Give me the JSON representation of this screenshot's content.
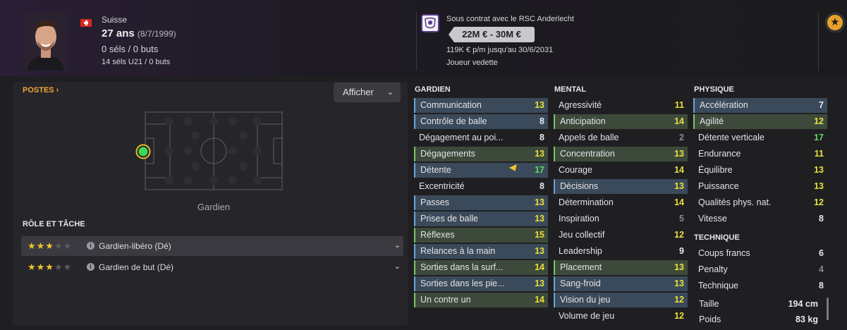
{
  "header": {
    "nationality": "Suisse",
    "age": "27 ans",
    "birthdate": "(8/7/1999)",
    "caps": "0 séls / 0 buts",
    "u21_caps": "14 séls U21 / 0 buts",
    "contract_club": "Sous contrat avec le RSC Anderlecht",
    "value_range": "22M € - 30M €",
    "wage": "119K € p/m jusqu'au 30/6/2031",
    "status": "Joueur vedette",
    "star_icon": "star-icon"
  },
  "positions": {
    "title": "POSTES ›",
    "display_button": "Afficher",
    "position_label": "Gardien"
  },
  "roles": {
    "title": "RÔLE ET TÂCHE",
    "items": [
      {
        "name": "Gardien-libéro (Dé)",
        "stars": 3,
        "max": 5
      },
      {
        "name": "Gardien de but (Dé)",
        "stars": 3,
        "max": 5
      }
    ]
  },
  "columns": {
    "goalkeeper": "GARDIEN",
    "mental": "MENTAL",
    "physical": "PHYSIQUE",
    "technical": "TECHNIQUE"
  },
  "goalkeeper": [
    {
      "name": "Communication",
      "value": "13",
      "hl": "hb",
      "color": "v-yellow"
    },
    {
      "name": "Contrôle de balle",
      "value": "8",
      "hl": "hb",
      "color": "v-white"
    },
    {
      "name": "Dégagement au poi...",
      "value": "8",
      "hl": "none",
      "color": "v-white"
    },
    {
      "name": "Dégagements",
      "value": "13",
      "hl": "hg",
      "color": "v-yellow"
    },
    {
      "name": "Détente",
      "value": "17",
      "hl": "hb",
      "color": "v-green"
    },
    {
      "name": "Excentricité",
      "value": "8",
      "hl": "none",
      "color": "v-white"
    },
    {
      "name": "Passes",
      "value": "13",
      "hl": "hb",
      "color": "v-yellow"
    },
    {
      "name": "Prises de balle",
      "value": "13",
      "hl": "hb",
      "color": "v-yellow"
    },
    {
      "name": "Réflexes",
      "value": "15",
      "hl": "hg",
      "color": "v-yellow"
    },
    {
      "name": "Relances à la main",
      "value": "13",
      "hl": "hb",
      "color": "v-yellow"
    },
    {
      "name": "Sorties dans la surf...",
      "value": "14",
      "hl": "hg",
      "color": "v-yellow"
    },
    {
      "name": "Sorties dans les pie...",
      "value": "13",
      "hl": "hb",
      "color": "v-yellow"
    },
    {
      "name": "Un contre un",
      "value": "14",
      "hl": "hg",
      "color": "v-yellow"
    }
  ],
  "mental": [
    {
      "name": "Agressivité",
      "value": "11",
      "hl": "none",
      "color": "v-yellow"
    },
    {
      "name": "Anticipation",
      "value": "14",
      "hl": "hg",
      "color": "v-yellow"
    },
    {
      "name": "Appels de balle",
      "value": "2",
      "hl": "none",
      "color": "v-gray"
    },
    {
      "name": "Concentration",
      "value": "13",
      "hl": "hg",
      "color": "v-yellow"
    },
    {
      "name": "Courage",
      "value": "14",
      "hl": "none",
      "color": "v-yellow"
    },
    {
      "name": "Décisions",
      "value": "13",
      "hl": "hb",
      "color": "v-yellow"
    },
    {
      "name": "Détermination",
      "value": "14",
      "hl": "none",
      "color": "v-yellow"
    },
    {
      "name": "Inspiration",
      "value": "5",
      "hl": "none",
      "color": "v-gray"
    },
    {
      "name": "Jeu collectif",
      "value": "12",
      "hl": "none",
      "color": "v-yellow"
    },
    {
      "name": "Leadership",
      "value": "9",
      "hl": "none",
      "color": "v-white"
    },
    {
      "name": "Placement",
      "value": "13",
      "hl": "hg",
      "color": "v-yellow"
    },
    {
      "name": "Sang-froid",
      "value": "13",
      "hl": "hb",
      "color": "v-yellow"
    },
    {
      "name": "Vision du jeu",
      "value": "12",
      "hl": "hb",
      "color": "v-yellow"
    },
    {
      "name": "Volume de jeu",
      "value": "12",
      "hl": "none",
      "color": "v-yellow"
    }
  ],
  "physical": [
    {
      "name": "Accélération",
      "value": "7",
      "hl": "hb",
      "color": "v-white"
    },
    {
      "name": "Agilité",
      "value": "12",
      "hl": "hg",
      "color": "v-yellow"
    },
    {
      "name": "Détente verticale",
      "value": "17",
      "hl": "none",
      "color": "v-green"
    },
    {
      "name": "Endurance",
      "value": "11",
      "hl": "none",
      "color": "v-yellow"
    },
    {
      "name": "Équilibre",
      "value": "13",
      "hl": "none",
      "color": "v-yellow"
    },
    {
      "name": "Puissance",
      "value": "13",
      "hl": "none",
      "color": "v-yellow"
    },
    {
      "name": "Qualités phys. nat.",
      "value": "12",
      "hl": "none",
      "color": "v-yellow"
    },
    {
      "name": "Vitesse",
      "value": "8",
      "hl": "none",
      "color": "v-white"
    }
  ],
  "technical": [
    {
      "name": "Coups francs",
      "value": "6",
      "hl": "none",
      "color": "v-white"
    },
    {
      "name": "Penalty",
      "value": "4",
      "hl": "none",
      "color": "v-gray"
    },
    {
      "name": "Technique",
      "value": "8",
      "hl": "none",
      "color": "v-white"
    }
  ],
  "body": {
    "height_label": "Taille",
    "height_value": "194 cm",
    "weight_label": "Poids",
    "weight_value": "83 kg"
  }
}
